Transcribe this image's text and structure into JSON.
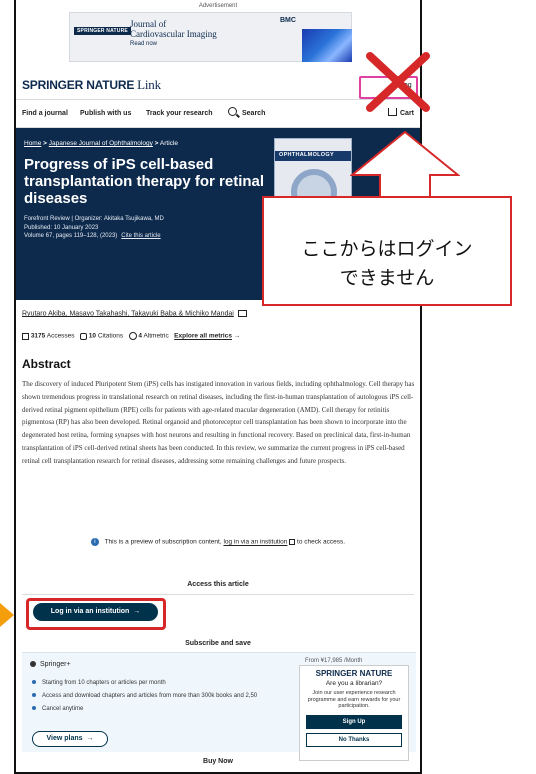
{
  "ad": {
    "label": "Advertisement",
    "publisher_badge": "SPRINGER NATURE",
    "journal_line1": "Journal of",
    "journal_line2": "Cardiovascular Imaging",
    "read_now": "Read now",
    "bmc": "BMC"
  },
  "header": {
    "logo_brand": "SPRINGER NATURE",
    "logo_link": "Link",
    "login_label": "Log"
  },
  "nav": {
    "find_journal": "Find a journal",
    "publish": "Publish with us",
    "track": "Track your research",
    "search": "Search",
    "cart": "Cart"
  },
  "hero": {
    "crumb_home": "Home",
    "crumb_journal": "Japanese Journal of Ophthalmology",
    "crumb_article": "Article",
    "sep": ">",
    "title": "Progress of iPS cell-based transplantation therapy for retinal diseases",
    "meta_line1": "Forefront Review | Organizer: Akitaka Tsujikawa, MD",
    "meta_line2": "Published: 10 January 2023",
    "meta_line3": "Volume 67, pages 119–128, (2023)",
    "cite": "Cite this article",
    "cover_title": "OPHTHALMOLOGY"
  },
  "callout": {
    "line1": "ここからはログイン",
    "line2": "できません",
    "colors": {
      "border": "#d62828"
    }
  },
  "authors": {
    "list": "Ryutaro Akiba, Masayo Takahashi, Takayuki Baba & Michiko Mandai"
  },
  "metrics": {
    "accesses_count": "3175",
    "accesses_label": "Accesses",
    "citations_count": "10",
    "citations_label": "Citations",
    "altmetric_count": "4",
    "altmetric_label": "Altmetric",
    "explore": "Explore all metrics"
  },
  "abstract": {
    "heading": "Abstract",
    "body": "The discovery of induced Pluripotent Stem (iPS) cells has instigated innovation in various fields, including ophthalmology. Cell therapy has shown tremendous progress in translational research on retinal diseases, including the first-in-human transplantation of autologous iPS cell-derived retinal pigment epithelium (RPE) cells for patients with age-related macular degeneration (AMD). Cell therapy for retinitis pigmentosa (RP) has also been developed. Retinal organoid and photoreceptor cell transplantation has been shown to incorporate into the degenerated host retina, forming synapses with host neurons and resulting in functional recovery. Based on preclinical data, first-in-human transplantation of iPS cell-derived retinal sheets has been conducted. In this review, we summarize the current progress in iPS cell-based retinal cell transplantation research for retinal diseases, addressing some remaining challenges and future prospects."
  },
  "preview": {
    "text_before": "This is a preview of subscription content,",
    "link": "log in via an institution",
    "text_after": "to check access."
  },
  "access": {
    "heading": "Access this article",
    "login_button": "Log in via an institution"
  },
  "subscribe": {
    "heading": "Subscribe and save",
    "plan_name": "Springer+",
    "price": "From ¥17,985 /Month",
    "bullets": [
      "Starting from 10 chapters or articles per month",
      "Access and download chapters and articles from more than 300k books and 2,50",
      "Cancel anytime"
    ],
    "view_plans": "View plans"
  },
  "popup": {
    "logo": "SPRINGER NATURE",
    "question": "Are you a librarian?",
    "body": "Join our user experience research programme and earn rewards for your participation.",
    "signup": "Sign Up",
    "no_thanks": "No Thanks"
  },
  "buy_now": "Buy Now"
}
